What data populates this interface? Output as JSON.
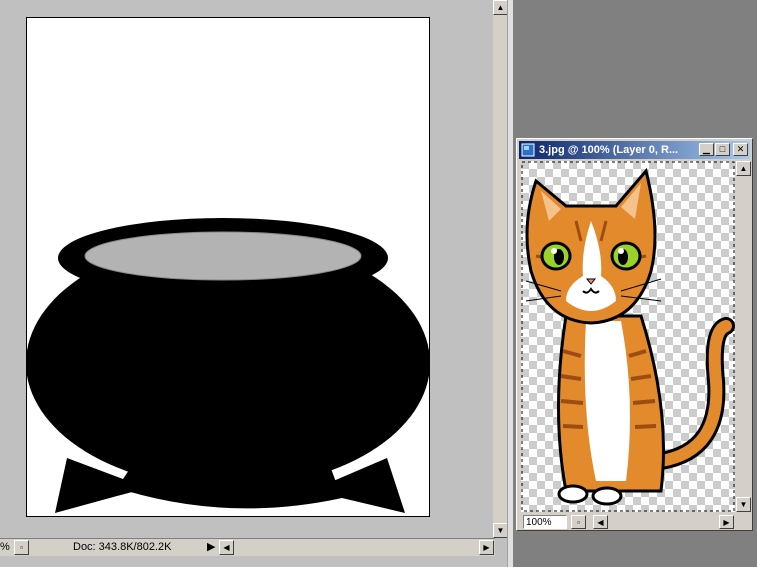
{
  "doc_window": {
    "zoom_fragment": "%",
    "doc_info": "Doc: 343.8K/802.2K"
  },
  "cat_window": {
    "title": "3.jpg @ 100% (Layer 0, R...",
    "zoom": "100%"
  },
  "icons": [
    "minimize-icon",
    "maximize-icon",
    "close-icon",
    "photoshop-document-icon",
    "scroll-up-icon",
    "scroll-down-icon",
    "scroll-left-icon",
    "scroll-right-icon",
    "status-menu-arrow-icon",
    "status-options-icon"
  ]
}
